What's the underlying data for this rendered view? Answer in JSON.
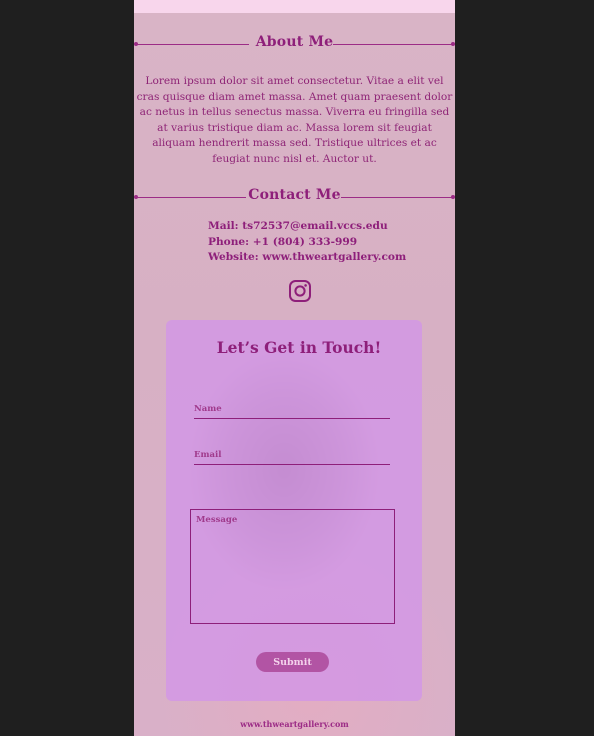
{
  "about": {
    "title": "About Me",
    "text": "Lorem ipsum dolor sit amet consectetur. Vitae a elit vel cras quisque diam amet massa. Amet quam praesent dolor ac netus in tellus senectus massa. Viverra eu fringilla sed at varius tristique diam ac. Massa lorem sit feugiat aliquam hendrerit massa sed. Tristique ultrices et ac feugiat nunc nisl et. Auctor ut."
  },
  "contact": {
    "title": "Contact Me",
    "mail": "Mail: ts72537@email.vccs.edu",
    "phone": "Phone: +1 (804) 333-999",
    "website": "Website: www.thweartgallery.com",
    "social_icon": "instagram-icon"
  },
  "form": {
    "title": "Let’s Get in Touch!",
    "name_placeholder": "Name",
    "email_placeholder": "Email",
    "message_placeholder": "Message",
    "submit_label": "Submit"
  },
  "footer": {
    "link": "www.thweartgallery.com"
  },
  "colors": {
    "accent": "#8e1f7a",
    "page_background": "#d9b4c6",
    "card_background": "#d296e6",
    "outer_background": "#1f1f1f"
  }
}
